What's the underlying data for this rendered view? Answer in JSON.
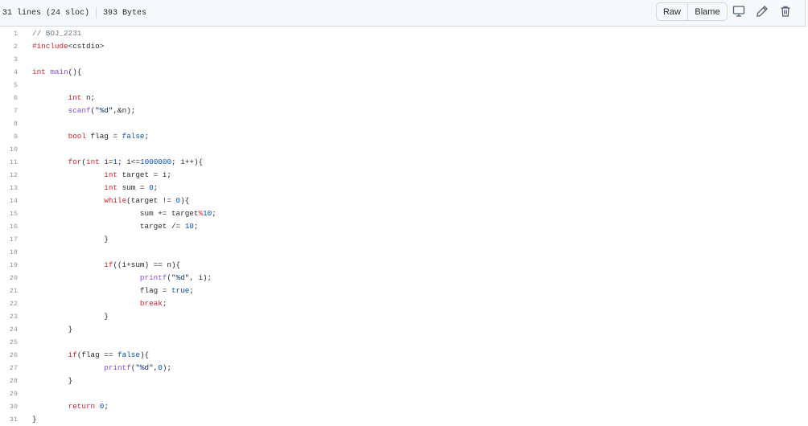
{
  "header": {
    "lines_info": "31 lines (24 sloc)",
    "size_info": "393 Bytes",
    "raw_label": "Raw",
    "blame_label": "Blame",
    "icons": [
      "desktop-icon",
      "pencil-icon",
      "trash-icon"
    ]
  },
  "code": {
    "lines": [
      {
        "n": "1",
        "indent": "",
        "tokens": [
          [
            "com",
            "// BOJ_2231"
          ]
        ]
      },
      {
        "n": "2",
        "indent": "",
        "tokens": [
          [
            "pre",
            "#include"
          ],
          [
            "plain",
            "<cstdio>"
          ]
        ]
      },
      {
        "n": "3",
        "indent": "",
        "tokens": []
      },
      {
        "n": "4",
        "indent": "",
        "tokens": [
          [
            "type",
            "int"
          ],
          [
            "plain",
            " "
          ],
          [
            "fn",
            "main"
          ],
          [
            "plain",
            "(){"
          ]
        ]
      },
      {
        "n": "5",
        "indent": "",
        "tokens": []
      },
      {
        "n": "6",
        "indent": "        ",
        "tokens": [
          [
            "type",
            "int"
          ],
          [
            "plain",
            " n;"
          ]
        ]
      },
      {
        "n": "7",
        "indent": "        ",
        "tokens": [
          [
            "fn",
            "scanf"
          ],
          [
            "plain",
            "("
          ],
          [
            "str",
            "\"%d\""
          ],
          [
            "plain",
            ",&n);"
          ]
        ]
      },
      {
        "n": "8",
        "indent": "",
        "tokens": []
      },
      {
        "n": "9",
        "indent": "        ",
        "tokens": [
          [
            "type",
            "bool"
          ],
          [
            "plain",
            " flag = "
          ],
          [
            "num",
            "false"
          ],
          [
            "plain",
            ";"
          ]
        ]
      },
      {
        "n": "10",
        "indent": "",
        "tokens": []
      },
      {
        "n": "11",
        "indent": "        ",
        "tokens": [
          [
            "key",
            "for"
          ],
          [
            "plain",
            "("
          ],
          [
            "type",
            "int"
          ],
          [
            "plain",
            " i="
          ],
          [
            "num",
            "1"
          ],
          [
            "plain",
            "; i<="
          ],
          [
            "num",
            "1000000"
          ],
          [
            "plain",
            "; i++){"
          ]
        ]
      },
      {
        "n": "12",
        "indent": "                ",
        "tokens": [
          [
            "type",
            "int"
          ],
          [
            "plain",
            " target = i;"
          ]
        ]
      },
      {
        "n": "13",
        "indent": "                ",
        "tokens": [
          [
            "type",
            "int"
          ],
          [
            "plain",
            " sum = "
          ],
          [
            "num",
            "0"
          ],
          [
            "plain",
            ";"
          ]
        ]
      },
      {
        "n": "14",
        "indent": "                ",
        "tokens": [
          [
            "key",
            "while"
          ],
          [
            "plain",
            "(target != "
          ],
          [
            "num",
            "0"
          ],
          [
            "plain",
            "){"
          ]
        ]
      },
      {
        "n": "15",
        "indent": "                        ",
        "tokens": [
          [
            "plain",
            "sum += target"
          ],
          [
            "key",
            "%"
          ],
          [
            "num",
            "10"
          ],
          [
            "plain",
            ";"
          ]
        ]
      },
      {
        "n": "16",
        "indent": "                        ",
        "tokens": [
          [
            "plain",
            "target /= "
          ],
          [
            "num",
            "10"
          ],
          [
            "plain",
            ";"
          ]
        ]
      },
      {
        "n": "17",
        "indent": "                ",
        "tokens": [
          [
            "plain",
            "}"
          ]
        ]
      },
      {
        "n": "18",
        "indent": "",
        "tokens": []
      },
      {
        "n": "19",
        "indent": "                ",
        "tokens": [
          [
            "key",
            "if"
          ],
          [
            "plain",
            "((i+sum) == n){"
          ]
        ]
      },
      {
        "n": "20",
        "indent": "                        ",
        "tokens": [
          [
            "fn",
            "printf"
          ],
          [
            "plain",
            "("
          ],
          [
            "str",
            "\"%d\""
          ],
          [
            "plain",
            ", i);"
          ]
        ]
      },
      {
        "n": "21",
        "indent": "                        ",
        "tokens": [
          [
            "plain",
            "flag = "
          ],
          [
            "num",
            "true"
          ],
          [
            "plain",
            ";"
          ]
        ]
      },
      {
        "n": "22",
        "indent": "                        ",
        "tokens": [
          [
            "key",
            "break"
          ],
          [
            "plain",
            ";"
          ]
        ]
      },
      {
        "n": "23",
        "indent": "                ",
        "tokens": [
          [
            "plain",
            "}"
          ]
        ]
      },
      {
        "n": "24",
        "indent": "        ",
        "tokens": [
          [
            "plain",
            "}"
          ]
        ]
      },
      {
        "n": "25",
        "indent": "",
        "tokens": []
      },
      {
        "n": "26",
        "indent": "        ",
        "tokens": [
          [
            "key",
            "if"
          ],
          [
            "plain",
            "(flag == "
          ],
          [
            "num",
            "false"
          ],
          [
            "plain",
            "){"
          ]
        ]
      },
      {
        "n": "27",
        "indent": "                ",
        "tokens": [
          [
            "fn",
            "printf"
          ],
          [
            "plain",
            "("
          ],
          [
            "str",
            "\"%d\""
          ],
          [
            "plain",
            ","
          ],
          [
            "num",
            "0"
          ],
          [
            "plain",
            ");"
          ]
        ]
      },
      {
        "n": "28",
        "indent": "        ",
        "tokens": [
          [
            "plain",
            "}"
          ]
        ]
      },
      {
        "n": "29",
        "indent": "",
        "tokens": []
      },
      {
        "n": "30",
        "indent": "        ",
        "tokens": [
          [
            "key",
            "return"
          ],
          [
            "plain",
            " "
          ],
          [
            "num",
            "0"
          ],
          [
            "plain",
            ";"
          ]
        ]
      },
      {
        "n": "31",
        "indent": "",
        "tokens": [
          [
            "plain",
            "}"
          ]
        ]
      }
    ]
  },
  "colors": {
    "keyword": "#cf222e",
    "function": "#8250df",
    "number": "#0550ae",
    "string": "#0a3069",
    "comment": "#6e7781",
    "line_number": "#8c959f",
    "header_bg": "#f6f8fa",
    "border": "#d0d7de"
  }
}
